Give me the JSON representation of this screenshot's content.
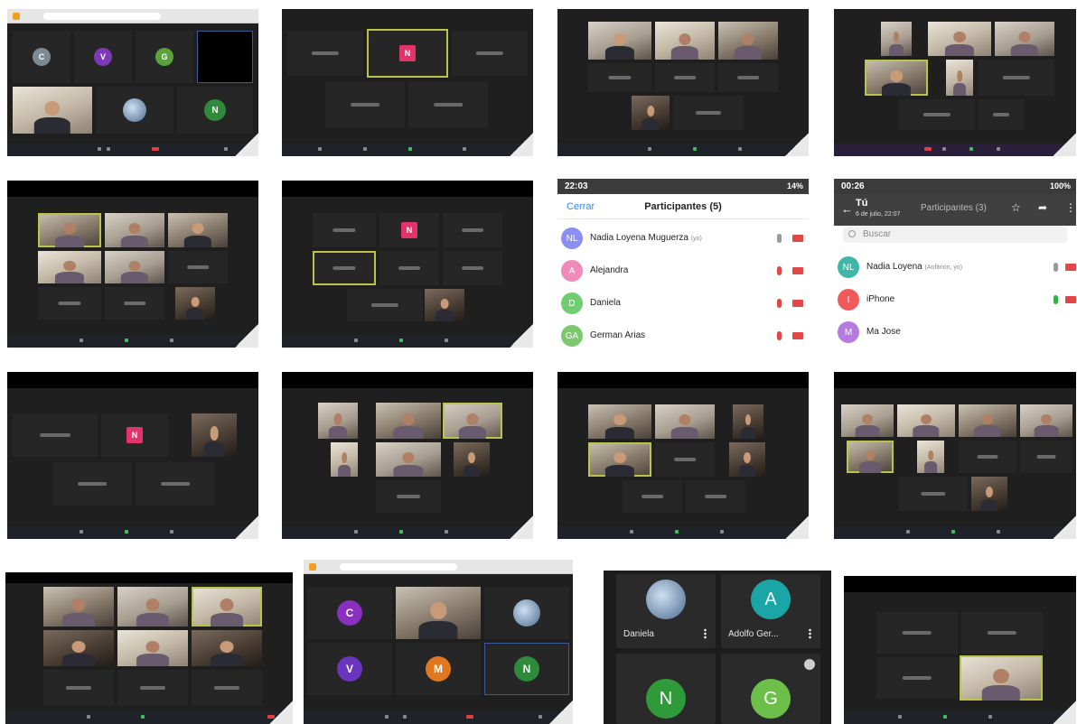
{
  "colors": {
    "zoom_tile_bg": "#262626",
    "active_speaker": "#b9c54a",
    "zoom_blue": "#2d8cff",
    "avatar_pink": "#e2336b"
  },
  "icons": [
    "menu-icon",
    "mic-icon",
    "camera-icon",
    "search-icon",
    "star-icon",
    "share-icon",
    "more-icon"
  ],
  "shots": {
    "s1": {
      "c": "C",
      "v": "V",
      "g": "G",
      "n": "N"
    },
    "s2": {
      "n": "N"
    },
    "s6": {
      "n": "N"
    },
    "s9": {
      "n": "N"
    },
    "s18": {
      "c": "C",
      "v": "V",
      "m": "M",
      "n": "N"
    },
    "s19": {
      "a": "A",
      "n": "N",
      "g": "G",
      "name_daniela": "Daniela",
      "name_adolfo": "Adolfo Ger..."
    }
  },
  "phone1": {
    "time": "22:03",
    "battery": "14%",
    "close_label": "Cerrar",
    "title": "Participantes (5)",
    "rows": [
      {
        "initials": "NL",
        "name": "Nadia Loyena Muguerza",
        "tag": "(yo)"
      },
      {
        "initials": "A",
        "name": "Alejandra"
      },
      {
        "initials": "D",
        "name": "Daniela"
      },
      {
        "initials": "GA",
        "name": "German Arias"
      }
    ]
  },
  "phone2": {
    "time": "00:26",
    "battery": "100%",
    "chat_name": "Tú",
    "chat_time": "6 de julio, 22:07",
    "title": "Participantes (3)",
    "search_placeholder": "Buscar",
    "rows": [
      {
        "initials": "NL",
        "name": "Nadia Loyena",
        "tag": "(Anfitrión, yo)"
      },
      {
        "initials": "I",
        "name": "iPhone"
      },
      {
        "initials": "M",
        "name": "Ma Jose"
      }
    ]
  }
}
